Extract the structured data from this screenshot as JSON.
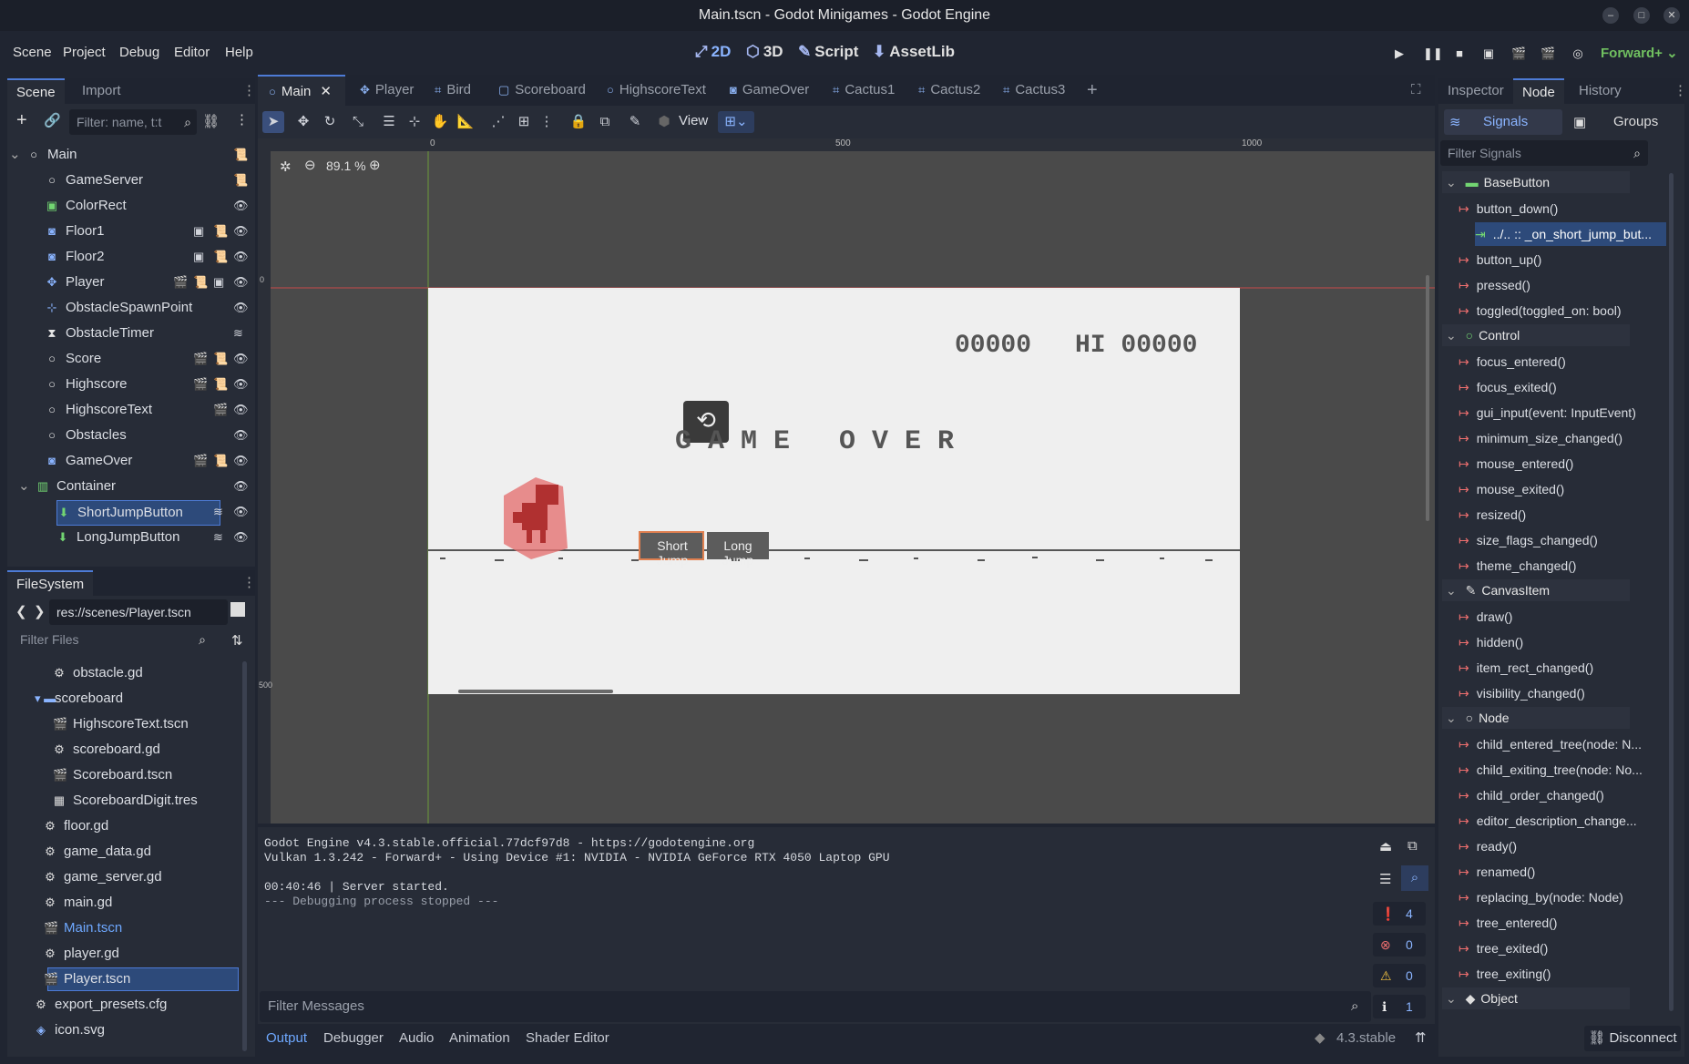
{
  "window": {
    "title": "Main.tscn - Godot Minigames - Godot Engine"
  },
  "menu": [
    "Scene",
    "Project",
    "Debug",
    "Editor",
    "Help"
  ],
  "main_buttons": {
    "b2d": "2D",
    "b3d": "3D",
    "script": "Script",
    "assetlib": "AssetLib"
  },
  "renderer": "Forward+",
  "scene_dock": {
    "tabs": [
      "Scene",
      "Import"
    ],
    "filter_placeholder": "Filter: name, t:t",
    "nodes": [
      {
        "name": "Main",
        "icon": "node-circle-icon"
      },
      {
        "name": "GameServer",
        "icon": "node-circle-icon"
      },
      {
        "name": "ColorRect",
        "icon": "colorrect-icon"
      },
      {
        "name": "Floor1",
        "icon": "staticbody-icon"
      },
      {
        "name": "Floor2",
        "icon": "staticbody-icon"
      },
      {
        "name": "Player",
        "icon": "node2d-icon"
      },
      {
        "name": "ObstacleSpawnPoint",
        "icon": "marker-icon"
      },
      {
        "name": "ObstacleTimer",
        "icon": "timer-icon"
      },
      {
        "name": "Score",
        "icon": "node-circle-icon"
      },
      {
        "name": "Highscore",
        "icon": "node-circle-icon"
      },
      {
        "name": "HighscoreText",
        "icon": "node-circle-icon"
      },
      {
        "name": "Obstacles",
        "icon": "node-circle-icon"
      },
      {
        "name": "GameOver",
        "icon": "staticbody-icon"
      },
      {
        "name": "Container",
        "icon": "container-icon"
      },
      {
        "name": "ShortJumpButton",
        "icon": "button-icon"
      },
      {
        "name": "LongJumpButton",
        "icon": "button-icon"
      }
    ]
  },
  "filesystem": {
    "title": "FileSystem",
    "path": "res://scenes/Player.tscn",
    "filter_placeholder": "Filter Files",
    "items": [
      "obstacle.gd",
      "scoreboard",
      "HighscoreText.tscn",
      "scoreboard.gd",
      "Scoreboard.tscn",
      "ScoreboardDigit.tres",
      "floor.gd",
      "game_data.gd",
      "game_server.gd",
      "main.gd",
      "Main.tscn",
      "player.gd",
      "Player.tscn",
      "export_presets.cfg",
      "icon.svg"
    ]
  },
  "editor_tabs": [
    "Main",
    "Player",
    "Bird",
    "Scoreboard",
    "HighscoreText",
    "GameOver",
    "Cactus1",
    "Cactus2",
    "Cactus3"
  ],
  "toolbar": {
    "view": "View"
  },
  "viewport": {
    "zoom": "89.1 %",
    "ruler_marks": [
      "0",
      "500",
      "1000"
    ],
    "ruler_v": [
      "0",
      "500"
    ],
    "score": "00000",
    "hi": "HI 00000",
    "game_over": "G A M E   O V E R",
    "short_jump": "Short Jump",
    "long_jump": "Long Jump"
  },
  "output": {
    "lines": [
      "Godot Engine v4.3.stable.official.77dcf97d8 - https://godotengine.org",
      "Vulkan 1.3.242 - Forward+ - Using Device #1: NVIDIA - NVIDIA GeForce RTX 4050 Laptop GPU",
      "",
      "00:40:46 | Server started.",
      "--- Debugging process stopped ---"
    ],
    "filter_placeholder": "Filter Messages",
    "counts": {
      "messages": "4",
      "errors": "0",
      "warnings": "0",
      "info": "1"
    }
  },
  "bottom_tabs": [
    "Output",
    "Debugger",
    "Audio",
    "Animation",
    "Shader Editor"
  ],
  "version": "4.3.stable",
  "inspector": {
    "tabs": [
      "Inspector",
      "Node",
      "History"
    ],
    "subtabs": {
      "signals": "Signals",
      "groups": "Groups"
    },
    "filter_placeholder": "Filter Signals",
    "categories": {
      "basebutton": "BaseButton",
      "control": "Control",
      "canvasitem": "CanvasItem",
      "node": "Node",
      "object": "Object"
    },
    "basebutton": [
      "button_down()",
      "../.. :: _on_short_jump_but...",
      "button_up()",
      "pressed()",
      "toggled(toggled_on: bool)"
    ],
    "control": [
      "focus_entered()",
      "focus_exited()",
      "gui_input(event: InputEvent)",
      "minimum_size_changed()",
      "mouse_entered()",
      "mouse_exited()",
      "resized()",
      "size_flags_changed()",
      "theme_changed()"
    ],
    "canvasitem": [
      "draw()",
      "hidden()",
      "item_rect_changed()",
      "visibility_changed()"
    ],
    "node": [
      "child_entered_tree(node: N...",
      "child_exiting_tree(node: No...",
      "child_order_changed()",
      "editor_description_change...",
      "ready()",
      "renamed()",
      "replacing_by(node: Node)",
      "tree_entered()",
      "tree_exited()",
      "tree_exiting()"
    ],
    "disconnect": "Disconnect"
  }
}
